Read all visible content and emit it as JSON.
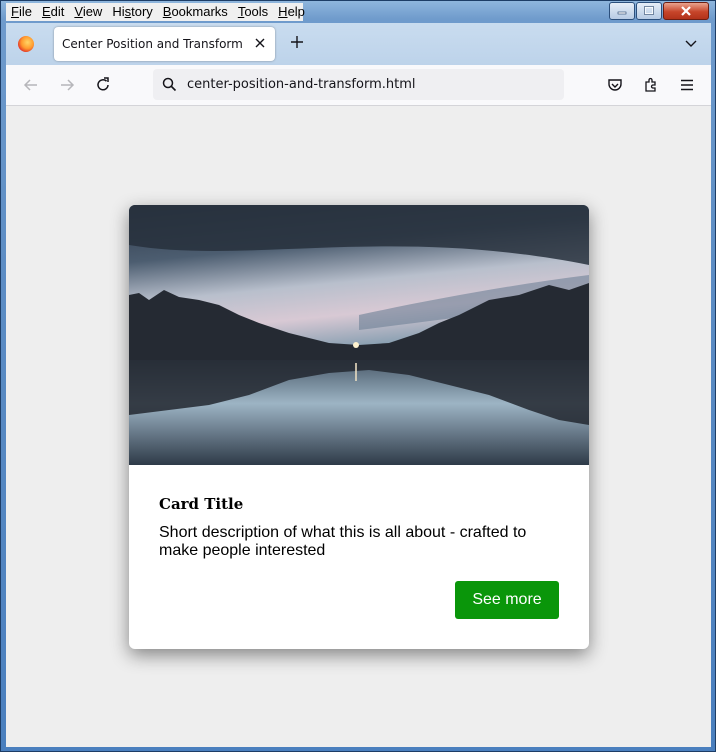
{
  "menubar": {
    "items": [
      {
        "first": "F",
        "rest": "ile"
      },
      {
        "first": "E",
        "rest": "dit"
      },
      {
        "first": "V",
        "rest": "iew"
      },
      {
        "first": "",
        "rest": "History",
        "pre": "Hi",
        "u": "s",
        "post": "tory"
      },
      {
        "first": "B",
        "rest": "ookmarks"
      },
      {
        "first": "T",
        "rest": "ools"
      },
      {
        "first": "H",
        "rest": "elp"
      }
    ]
  },
  "tab": {
    "title": "Center Position and Transform"
  },
  "navbar": {
    "url": "center-position-and-transform.html"
  },
  "card": {
    "title": "Card Title",
    "description": "Short description of what this is all about - crafted to make people interested",
    "button_label": "See more"
  },
  "colors": {
    "button": "#0a960a",
    "page_bg": "#eeeeee"
  },
  "icons": [
    "firefox-icon",
    "close-icon",
    "plus-icon",
    "chevron-down-icon",
    "back-arrow-icon",
    "forward-arrow-icon",
    "reload-icon",
    "search-icon",
    "pocket-icon",
    "extensions-icon",
    "hamburger-menu-icon",
    "minimize-icon",
    "maximize-icon",
    "window-close-icon"
  ]
}
